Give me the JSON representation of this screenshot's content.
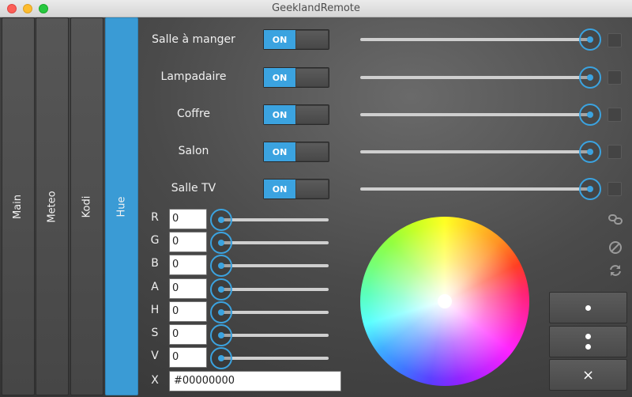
{
  "window": {
    "title": "GeeklandRemote"
  },
  "tabs": [
    {
      "label": "Main"
    },
    {
      "label": "Meteo"
    },
    {
      "label": "Kodi"
    },
    {
      "label": "Hue"
    }
  ],
  "lights": [
    {
      "name": "Salle à manger",
      "state": "ON",
      "brightness": 1.0
    },
    {
      "name": "Lampadaire",
      "state": "ON",
      "brightness": 1.0
    },
    {
      "name": "Coffre",
      "state": "ON",
      "brightness": 1.0
    },
    {
      "name": "Salon",
      "state": "ON",
      "brightness": 1.0
    },
    {
      "name": "Salle TV",
      "state": "ON",
      "brightness": 1.0
    }
  ],
  "channels": [
    {
      "label": "R",
      "value": "0"
    },
    {
      "label": "G",
      "value": "0"
    },
    {
      "label": "B",
      "value": "0"
    },
    {
      "label": "A",
      "value": "0"
    },
    {
      "label": "H",
      "value": "0"
    },
    {
      "label": "S",
      "value": "0"
    },
    {
      "label": "V",
      "value": "0"
    }
  ],
  "hex": {
    "label": "X",
    "value": "#00000000"
  },
  "side_icons": [
    "link-icon",
    "block-icon",
    "refresh-icon"
  ],
  "actions": [
    {
      "name": "single-dot-button",
      "label": "•"
    },
    {
      "name": "double-dot-button",
      "label": ""
    },
    {
      "name": "close-button",
      "label": "×"
    }
  ],
  "colors": {
    "accent": "#3ba3e0",
    "active_tab": "#3a9bd5"
  }
}
